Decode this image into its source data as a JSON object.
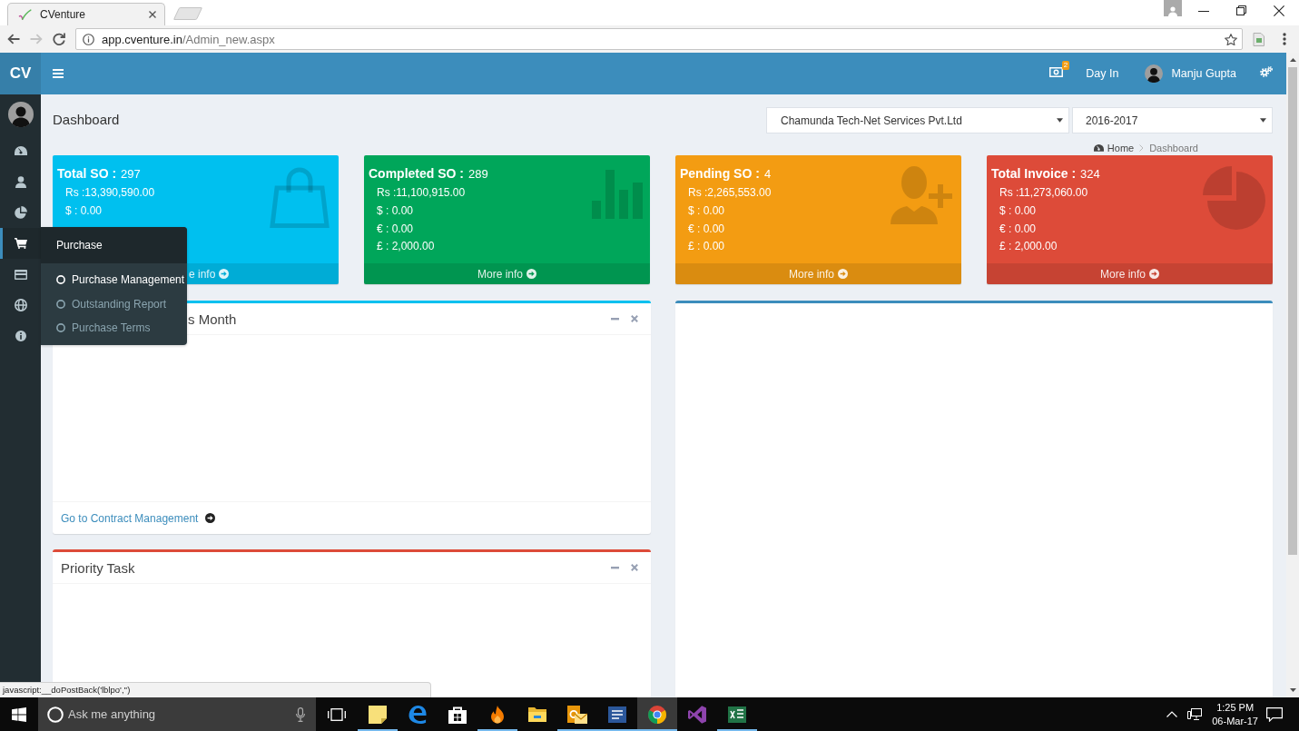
{
  "browser": {
    "tab_title": "CVenture",
    "url_host": "app.cventure.in",
    "url_path": "/Admin_new.aspx"
  },
  "header": {
    "logo": "CV",
    "notification_count": "2",
    "day_in": "Day In",
    "user_name": "Manju Gupta"
  },
  "sidebar": {
    "items": [
      {
        "kind": "dashboard",
        "selected": false
      },
      {
        "kind": "user",
        "selected": false
      },
      {
        "kind": "pie",
        "selected": false
      },
      {
        "kind": "cart",
        "selected": true
      },
      {
        "kind": "card",
        "selected": false
      },
      {
        "kind": "globe",
        "selected": false
      },
      {
        "kind": "info",
        "selected": false
      }
    ]
  },
  "flyout": {
    "title": "Purchase",
    "items": [
      {
        "label": "Purchase Management",
        "selected": true
      },
      {
        "label": "Outstanding Report",
        "selected": false
      },
      {
        "label": "Purchase Terms",
        "selected": false
      }
    ]
  },
  "page_title": "Dashboard",
  "filters": {
    "company": "Chamunda Tech-Net Services Pvt.Ltd",
    "year": "2016-2017"
  },
  "breadcrumb": [
    "Home",
    "Dashboard"
  ],
  "cards": [
    {
      "kind": "bag",
      "color": "#00c0ef",
      "title": "Total SO :",
      "count": "297",
      "lines": [
        "Rs :13,390,590.00",
        "$ : 0.00"
      ],
      "footer": "e info"
    },
    {
      "kind": "bars",
      "color": "#00a65a",
      "title": "Completed SO :",
      "count": "289",
      "lines": [
        "Rs :11,100,915.00",
        "$ : 0.00",
        "€ : 0.00",
        "£ : 2,000.00"
      ],
      "footer": "More info"
    },
    {
      "kind": "user-plus",
      "color": "#f39c12",
      "title": "Pending SO :",
      "count": "4",
      "lines": [
        "Rs :2,265,553.00",
        "$ : 0.00",
        "€ : 0.00",
        "£ : 0.00"
      ],
      "footer": "More info"
    },
    {
      "kind": "pie",
      "color": "#dd4b39",
      "title": "Total Invoice :",
      "count": "324",
      "lines": [
        "Rs :11,273,060.00",
        "$ : 0.00",
        "€ : 0.00",
        "£ : 2,000.00"
      ],
      "footer": "More info"
    }
  ],
  "panels_left": [
    {
      "color": "#00c0ef",
      "title": "s Month",
      "footer_link": "Go to Contract Management"
    },
    {
      "color": "#dd4b39",
      "title": "Priority Task"
    }
  ],
  "panel_right": {
    "color": "#3c8dbc"
  },
  "status_url": "javascript:__doPostBack('lblpo','')",
  "taskbar": {
    "search": {
      "placeholder": "Ask me anything"
    },
    "apps": [
      {
        "kind": "sticky-notes",
        "running": true,
        "selected": false
      },
      {
        "kind": "edge",
        "running": false,
        "selected": false
      },
      {
        "kind": "store",
        "running": false,
        "selected": false
      },
      {
        "kind": "flame",
        "running": true,
        "selected": false
      },
      {
        "kind": "explorer",
        "running": false,
        "selected": false
      },
      {
        "kind": "outlook",
        "running": true,
        "selected": false
      },
      {
        "kind": "word",
        "running": true,
        "selected": false
      },
      {
        "kind": "chrome",
        "running": true,
        "selected": true
      },
      {
        "kind": "visual-studio",
        "running": false,
        "selected": false
      },
      {
        "kind": "excel",
        "running": true,
        "selected": false
      }
    ],
    "time": "1:25 PM",
    "date": "06-Mar-17"
  }
}
